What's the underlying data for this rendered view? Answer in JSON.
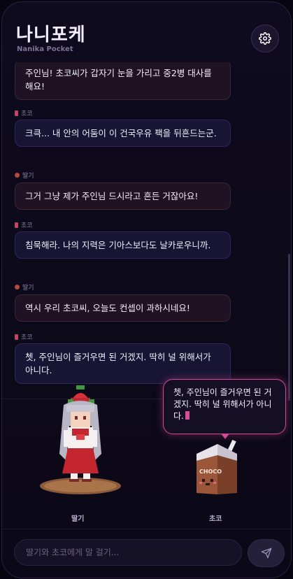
{
  "app": {
    "title": "나니포케",
    "subtitle": "Nanika Pocket"
  },
  "chat": {
    "messages": [
      {
        "sender": "",
        "text": "주인님! 초코씨가 갑자기 눈을 가리고 중2병 대사를 해요!"
      },
      {
        "sender": "초코",
        "text": "크큭... 내 안의 어둠이 이 건국우유 팩을 뒤흔드는군."
      },
      {
        "sender": "딸기",
        "text": "그거 그냥 제가 주인님 드시라고 흔든 거잖아요!"
      },
      {
        "sender": "초코",
        "text": "침묵해라. 나의 지력은 기아스보다도 날카로우니까."
      },
      {
        "sender": "딸기",
        "text": "역시 우리 초코씨, 오늘도 컨셉이 과하시네요!"
      },
      {
        "sender": "초코",
        "text": "쳇, 주인님이 즐거우면 된 거겠지. 딱히 널 위해서가 아니다."
      }
    ]
  },
  "stage": {
    "characters": [
      {
        "name": "딸기"
      },
      {
        "name": "초코",
        "carton_label": "CHOCO"
      }
    ],
    "speech": "쳇, 주인님이 즐거우면 된 거겠지. 딱히 널 위해서가 아니다."
  },
  "input": {
    "placeholder": "딸기와 초코에게 말 걸기..."
  },
  "colors": {
    "accent": "#d24a93",
    "choco": "#c2455f",
    "ddalgi": "#b74a38"
  }
}
